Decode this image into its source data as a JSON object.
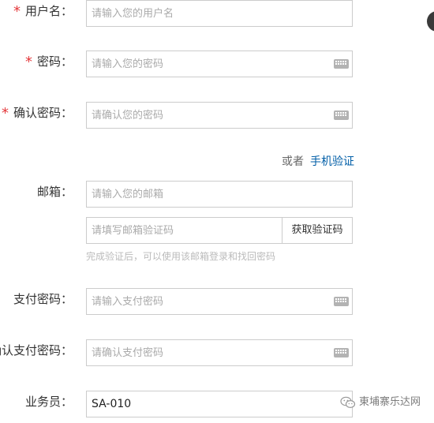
{
  "form": {
    "required_mark": "*",
    "username": {
      "label": "用户名：",
      "placeholder": "请输入您的用户名"
    },
    "password": {
      "label": "密码：",
      "placeholder": "请输入您的密码"
    },
    "confirm_password": {
      "label": "确认密码：",
      "placeholder": "请确认您的密码"
    },
    "alt_verify": {
      "or_text": "或者",
      "link_text": "手机验证"
    },
    "email": {
      "label": "邮箱：",
      "placeholder": "请输入您的邮箱"
    },
    "email_code": {
      "placeholder": "请填写邮箱验证码",
      "button_label": "获取验证码",
      "hint": "完成验证后，可以使用该邮箱登录和找回密码"
    },
    "pay_password": {
      "label": "支付密码：",
      "placeholder": "请输入支付密码"
    },
    "confirm_pay_password": {
      "label": "确认支付密码：",
      "placeholder": "请确认支付密码"
    },
    "salesperson": {
      "label": "业务员：",
      "value": "SA-010"
    }
  },
  "icons": {
    "keyboard": "keyboard-icon",
    "wechat": "wechat-icon"
  },
  "watermark": {
    "text": "東埔寨乐达网"
  },
  "colors": {
    "required": "#e4393c",
    "link": "#005ea7",
    "border": "#cccccc",
    "placeholder": "#aaaaaa",
    "hint": "#bbbbbb"
  }
}
